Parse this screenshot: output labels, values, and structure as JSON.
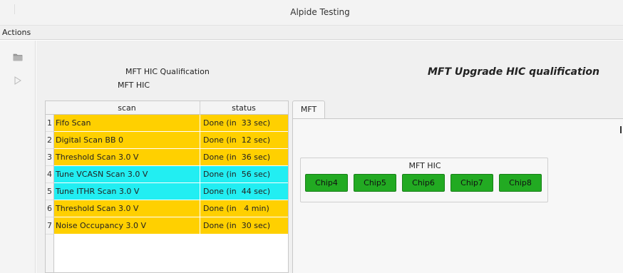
{
  "window": {
    "title": "Alpide Testing"
  },
  "menu": {
    "actions": "Actions"
  },
  "toolbar": {
    "items": [
      {
        "icon": "folder-icon"
      },
      {
        "icon": "play-icon"
      }
    ]
  },
  "info": {
    "test_name": "MFT HIC Qualification",
    "hic": "MFT HIC",
    "heading": "MFT Upgrade HIC qualification"
  },
  "table": {
    "headers": [
      "scan",
      "status"
    ],
    "rows": [
      {
        "num": "1",
        "scan": "Fifo Scan",
        "status": "Done (in  33 sec)",
        "color": "#ffd000"
      },
      {
        "num": "2",
        "scan": "Digital Scan BB 0",
        "status": "Done (in  12 sec)",
        "color": "#ffd000"
      },
      {
        "num": "3",
        "scan": "Threshold Scan 3.0 V",
        "status": "Done (in  36 sec)",
        "color": "#ffd000"
      },
      {
        "num": "4",
        "scan": "Tune VCASN Scan 3.0 V",
        "status": "Done (in  56 sec)",
        "color": "#22eef2"
      },
      {
        "num": "5",
        "scan": "Tune ITHR Scan 3.0 V",
        "status": "Done (in  44 sec)",
        "color": "#22eef2"
      },
      {
        "num": "6",
        "scan": "Threshold Scan 3.0 V",
        "status": "Done (in   4 min)",
        "color": "#ffd000"
      },
      {
        "num": "7",
        "scan": "Noise Occupancy 3.0 V",
        "status": "Done (in  30 sec)",
        "color": "#ffd000"
      }
    ]
  },
  "tabs": {
    "items": [
      "MFT"
    ]
  },
  "hic_panel": {
    "label": "MFT HIC",
    "chips": [
      "Chip4",
      "Chip5",
      "Chip6",
      "Chip7",
      "Chip8"
    ],
    "chip_color": "#22aa22"
  }
}
